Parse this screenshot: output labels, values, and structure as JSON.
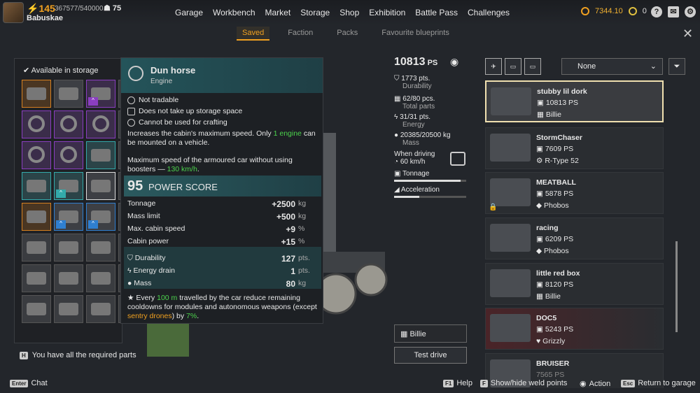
{
  "player": {
    "level": "145",
    "xp": "367577/540000",
    "rank": "75",
    "name": "Babuskae"
  },
  "nav": [
    "Garage",
    "Workbench",
    "Market",
    "Storage",
    "Shop",
    "Exhibition",
    "Battle Pass",
    "Challenges"
  ],
  "currency": {
    "coins": "7344.10",
    "badges": "0"
  },
  "subtabs": [
    "Saved",
    "Faction",
    "Packs",
    "Favourite blueprints"
  ],
  "storage": {
    "title": "Available in storage",
    "required": "You have all the required parts"
  },
  "tooltip": {
    "name": "Dun horse",
    "type": "Engine",
    "flags": [
      "Not tradable",
      "Does not take up storage space",
      "Cannot be used for crafting"
    ],
    "desc1_a": "Increases the cabin's maximum speed. Only ",
    "desc1_b": "1 engine",
    "desc1_c": " can be mounted on a vehicle.",
    "desc2_a": "Maximum speed of the armoured car without using boosters — ",
    "desc2_b": "130 km/h",
    ".": "",
    "desc2_c": ".",
    "ps_value": "95",
    "ps_label": "POWER SCORE",
    "stats": [
      {
        "label": "Tonnage",
        "value": "+2500",
        "unit": "kg"
      },
      {
        "label": "Mass limit",
        "value": "+500",
        "unit": "kg"
      },
      {
        "label": "Max. cabin speed",
        "value": "+9",
        "unit": "%"
      },
      {
        "label": "Cabin power",
        "value": "+15",
        "unit": "%"
      }
    ],
    "stats2": [
      {
        "label": "Durability",
        "value": "127",
        "unit": "pts."
      },
      {
        "label": "Energy drain",
        "value": "1",
        "unit": "pts."
      },
      {
        "label": "Mass",
        "value": "80",
        "unit": "kg"
      }
    ],
    "perk_a": "Every ",
    "perk_b": "100 m",
    "perk_c": " travelled by the car reduce remaining cooldowns for modules and autonomous weapons (except ",
    "perk_d": "sentry drones",
    "perk_e": ") by ",
    "perk_f": "7%",
    "perk_g": "."
  },
  "vehicle": {
    "ps": "10813",
    "ps_unit": "PS",
    "durability": "1773 pts.",
    "durability_lbl": "Durability",
    "parts": "62/80 pcs.",
    "parts_lbl": "Total parts",
    "energy": "31/31 pts.",
    "energy_lbl": "Energy",
    "mass": "20385/20500 kg",
    "mass_lbl": "Mass",
    "driving_lbl": "When driving",
    "speed": "60 km/h",
    "tonnage_lbl": "Tonnage",
    "tonnage_fill": 0.92,
    "accel_lbl": "Acceleration",
    "accel_fill": 0.35,
    "crew": "Billie",
    "test": "Test drive"
  },
  "filter": {
    "selected": "None"
  },
  "cars": [
    {
      "name": "stubby lil dork",
      "ps": "10813 PS",
      "owner": "Billie"
    },
    {
      "name": "StormChaser",
      "ps": "7609 PS",
      "owner": "R-Type 52"
    },
    {
      "name": "MEATBALL",
      "ps": "5878 PS",
      "owner": "Phobos"
    },
    {
      "name": "racing",
      "ps": "6209 PS",
      "owner": "Phobos"
    },
    {
      "name": "little red box",
      "ps": "8120 PS",
      "owner": "Billie"
    },
    {
      "name": "DOC5",
      "ps": "5243 PS",
      "owner": "Grizzly"
    },
    {
      "name": "BRUISER",
      "ps": "7565 PS",
      "owner": ""
    }
  ],
  "bottom": {
    "chat_key": "Enter",
    "chat": "Chat",
    "help_key": "F1",
    "help": "Help",
    "weld_key": "F",
    "weld": "Show/hide weld points",
    "action": "Action",
    "return_key": "Esc",
    "return": "Return to garage"
  }
}
